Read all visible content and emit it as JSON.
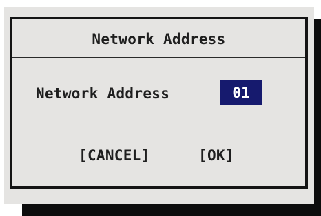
{
  "dialog": {
    "title": "Network Address",
    "field": {
      "label": "Network Address",
      "value": "01"
    },
    "buttons": {
      "cancel": "[CANCEL]",
      "ok": "[OK]"
    }
  },
  "colors": {
    "panel_background": "#e5e4e2",
    "border": "#141414",
    "selected_value_background": "#161a6e",
    "selected_value_text": "#ffffff",
    "shadow": "#0d0d0d"
  }
}
